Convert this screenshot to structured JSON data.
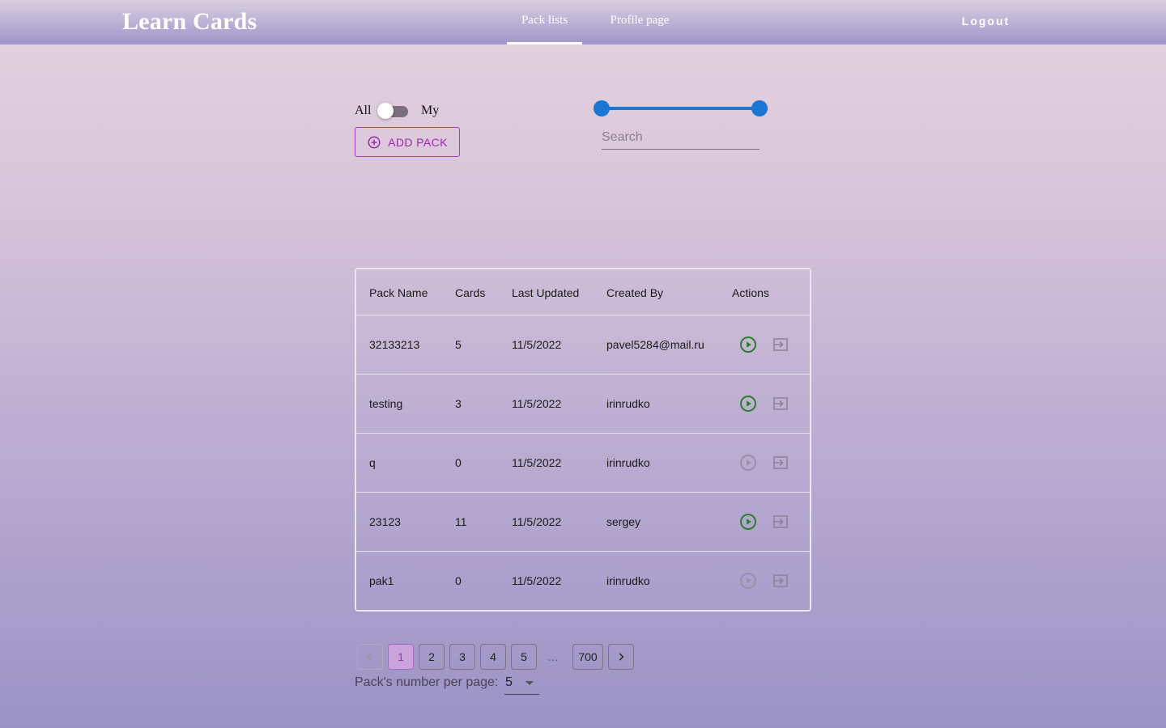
{
  "header": {
    "logo": "Learn Cards",
    "tabs": [
      {
        "label": "Pack lists",
        "active": true
      },
      {
        "label": "Profile page",
        "active": false
      }
    ],
    "logout_label": "Logout"
  },
  "filters": {
    "toggle_left_label": "All",
    "toggle_right_label": "My",
    "toggle_state": "All",
    "add_pack_label": "ADD PACK",
    "search_placeholder": "Search",
    "search_value": ""
  },
  "table": {
    "headers": [
      "Pack Name",
      "Cards",
      "Last Updated",
      "Created By",
      "Actions"
    ],
    "rows": [
      {
        "name": "32133213",
        "cards": "5",
        "updated": "11/5/2022",
        "created_by": "pavel5284@mail.ru",
        "learn_enabled": true
      },
      {
        "name": "testing",
        "cards": "3",
        "updated": "11/5/2022",
        "created_by": "irinrudko",
        "learn_enabled": true
      },
      {
        "name": "q",
        "cards": "0",
        "updated": "11/5/2022",
        "created_by": "irinrudko",
        "learn_enabled": false
      },
      {
        "name": "23123",
        "cards": "11",
        "updated": "11/5/2022",
        "created_by": "sergey",
        "learn_enabled": true
      },
      {
        "name": "pak1",
        "cards": "0",
        "updated": "11/5/2022",
        "created_by": "irinrudko",
        "learn_enabled": false
      }
    ]
  },
  "pagination": {
    "pages": [
      "1",
      "2",
      "3",
      "4",
      "5"
    ],
    "current": "1",
    "ellipsis": "…",
    "last_page": "700",
    "per_page_label": "Pack's number per page:",
    "per_page_value": "5"
  },
  "colors": {
    "accent_purple": "#9c27b0",
    "slider_blue": "#1976d2",
    "play_enabled": "#2e7d32",
    "play_disabled": "#9a8fa8"
  },
  "icons": {
    "add": "add-circle-icon",
    "learn": "play-circle-icon",
    "open": "open-pack-icon",
    "prev": "chevron-left-icon",
    "next": "chevron-right-icon",
    "dropdown": "caret-down-icon"
  }
}
